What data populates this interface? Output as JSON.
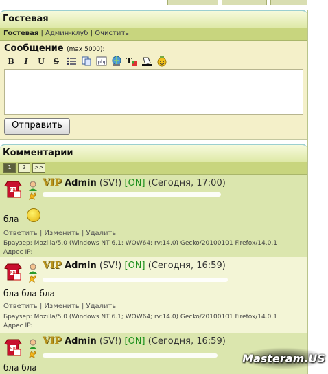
{
  "guestbook": {
    "title": "Гостевая",
    "nav": {
      "current": "Гостевая",
      "sep1": "|",
      "admin": "Админ-клуб",
      "sep2": "|",
      "clear": "Очистить"
    }
  },
  "form": {
    "label": "Сообщение",
    "limit": "(max 5000):",
    "submit_label": "Отправить",
    "toolbar": [
      "bold-icon",
      "italic-icon",
      "underline-icon",
      "strike-icon",
      "list-icon",
      "copy-icon",
      "php-icon",
      "link-icon",
      "color-icon",
      "fill-icon",
      "smiley-icon"
    ]
  },
  "comments": {
    "title": "Комментарии",
    "pages": [
      "1",
      "2",
      ">>"
    ],
    "items": [
      {
        "vip": "VIP",
        "name": "Admin",
        "tag": "(SV!)",
        "status": "[ON]",
        "date": "(Сегодня, 17:00)",
        "text": "бла",
        "reply": "Ответить",
        "edit": "Изменить",
        "delete": "Удалить",
        "ua": "Браузер: Mozilla/5.0 (Windows NT 6.1; WOW64; rv:14.0) Gecko/20100101 Firefox/14.0.1",
        "ip": "Адрес IP:"
      },
      {
        "vip": "VIP",
        "name": "Admin",
        "tag": "(SV!)",
        "status": "[ON]",
        "date": "(Сегодня, 16:59)",
        "text": "бла бла бла",
        "reply": "Ответить",
        "edit": "Изменить",
        "delete": "Удалить",
        "ua": "Браузер: Mozilla/5.0 (Windows NT 6.1; WOW64; rv:14.0) Gecko/20100101 Firefox/14.0.1",
        "ip": "Адрес IP:"
      },
      {
        "vip": "VIP",
        "name": "Admin",
        "tag": "(SV!)",
        "status": "[ON]",
        "date": "(Сегодня, 16:59)",
        "text": "бла бла"
      }
    ]
  },
  "watermark": "Masteram.US"
}
